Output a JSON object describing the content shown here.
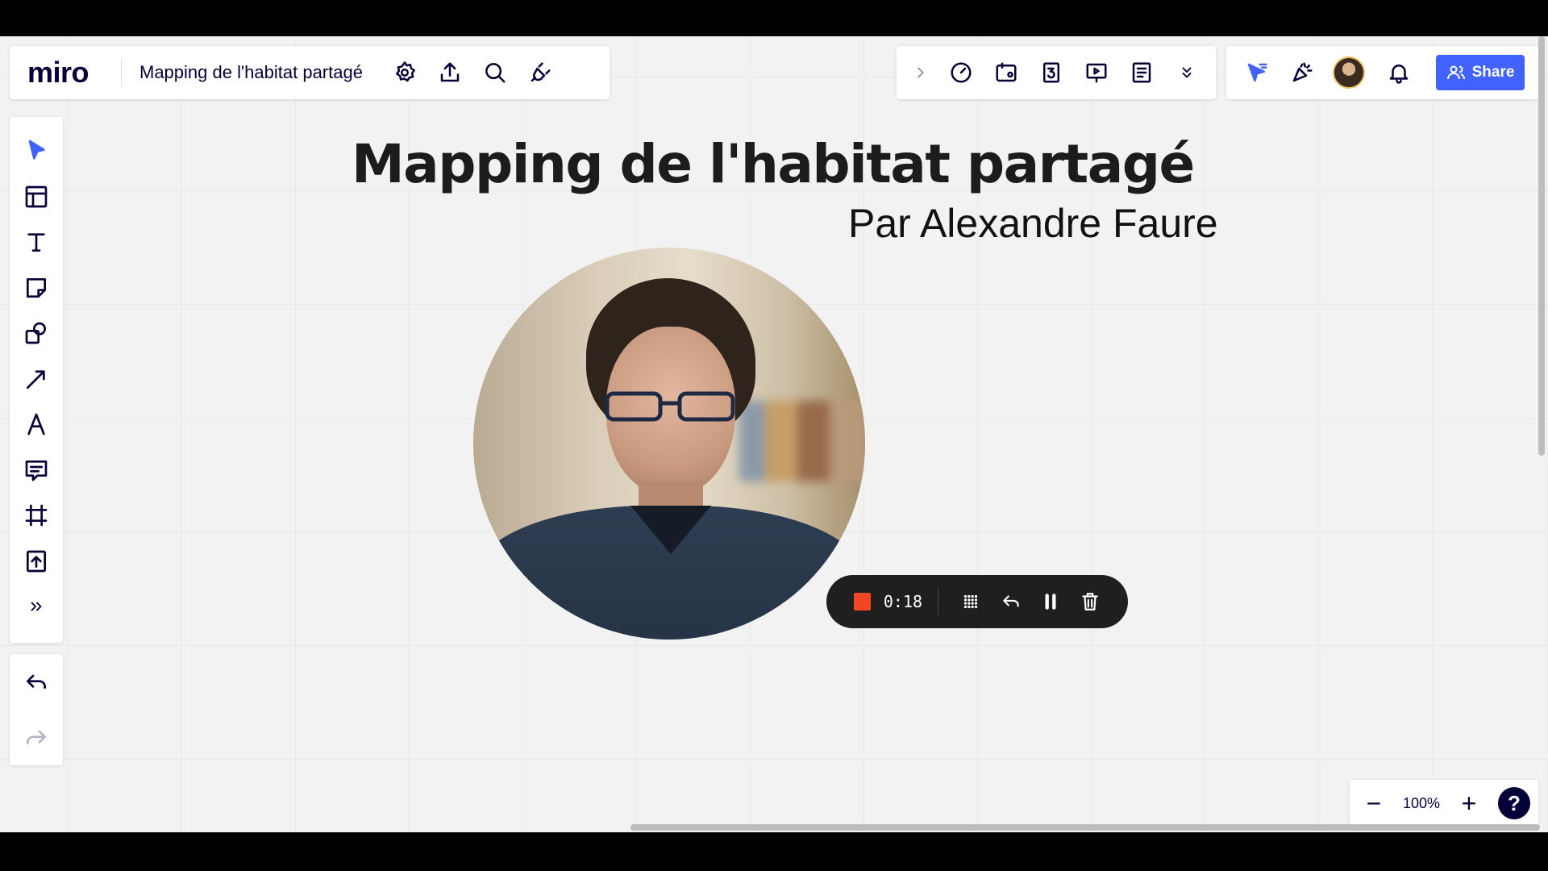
{
  "app": {
    "logo": "miro",
    "board_title": "Mapping de l'habitat partagé"
  },
  "board": {
    "title": "Mapping de l'habitat partagé",
    "subtitle": "Par Alexandre Faure"
  },
  "top_left_icons": [
    "gear-icon",
    "upload-icon",
    "search-icon",
    "plug-icon"
  ],
  "top_center_icons": [
    "chevron-right-icon",
    "timer-icon",
    "card-icon",
    "countdown-icon",
    "presentation-icon",
    "notes-icon",
    "double-chevron-down-icon"
  ],
  "top_right": {
    "icons": [
      "cursor-filter-icon",
      "celebrate-icon",
      "avatar",
      "bell-icon"
    ],
    "share_label": "Share"
  },
  "left_tools": [
    "select-icon",
    "templates-icon",
    "text-icon",
    "sticky-note-icon",
    "shapes-icon",
    "arrow-line-icon",
    "pen-icon",
    "comment-icon",
    "frame-icon",
    "upload-icon",
    "more-tools-icon"
  ],
  "recording": {
    "time": "0:18",
    "stop_color": "#f24726"
  },
  "zoom": {
    "minus": "−",
    "level": "100%",
    "plus": "+",
    "help": "?"
  },
  "colors": {
    "accent": "#4262ff",
    "canvas": "#f2f2f2",
    "ink": "#050038"
  }
}
